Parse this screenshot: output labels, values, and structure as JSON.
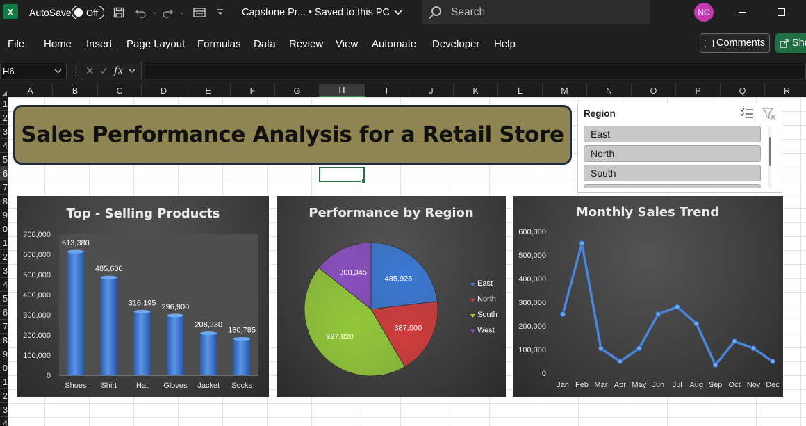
{
  "titlebar": {
    "app_icon": "X",
    "autosave_label": "AutoSave",
    "autosave_state": "Off",
    "doc_title": "Capstone Pr...  •  Saved to this PC",
    "search_placeholder": "Search",
    "user_initials": "NC"
  },
  "ribbon": {
    "tabs": [
      "File",
      "Home",
      "Insert",
      "Page Layout",
      "Formulas",
      "Data",
      "Review",
      "View",
      "Automate",
      "Developer",
      "Help"
    ],
    "comments_label": "Comments",
    "share_label": "Sha"
  },
  "formula_bar": {
    "name_box": "H6",
    "fx_label": "fx",
    "formula": ""
  },
  "sheet": {
    "columns": [
      "A",
      "B",
      "C",
      "D",
      "E",
      "F",
      "G",
      "H",
      "I",
      "J",
      "K",
      "L",
      "M",
      "N",
      "O",
      "P",
      "Q",
      "R"
    ],
    "selected_column": "H",
    "rows": [
      "1",
      "2",
      "3",
      "4",
      "5",
      "6",
      "7",
      "8",
      "9",
      "0",
      "1",
      "2",
      "3",
      "4",
      "5",
      "6",
      "7",
      "8",
      "9",
      "0",
      "1",
      "2",
      "3",
      "4"
    ],
    "selected_row_index": 5
  },
  "banner": {
    "title": "Sales Performance Analysis for a Retail Store"
  },
  "slicer": {
    "header": "Region",
    "items": [
      "East",
      "North",
      "South"
    ],
    "multiselect_icon": "multiselect-icon",
    "clear_filter_icon": "clear-filter-icon"
  },
  "chart_data": [
    {
      "type": "bar",
      "title": "Top - Selling Products",
      "categories": [
        "Shoes",
        "Shirt",
        "Hat",
        "Gloves",
        "Jacket",
        "Socks"
      ],
      "values": [
        613380,
        485600,
        316195,
        296900,
        208230,
        180785
      ],
      "value_labels": [
        "613,380",
        "485,600",
        "316,195",
        "296,900",
        "208,230",
        "180,785"
      ],
      "ylim": [
        0,
        700000
      ],
      "yticks": [
        "0",
        "100,000",
        "200,000",
        "300,000",
        "400,000",
        "500,000",
        "600,000",
        "700,000"
      ],
      "color": "#3a78d4",
      "xlabel": "",
      "ylabel": ""
    },
    {
      "type": "pie",
      "title": "Performance by Region",
      "categories": [
        "East",
        "North",
        "South",
        "West"
      ],
      "values": [
        485925,
        387000,
        927820,
        300345
      ],
      "value_labels": [
        "485,925",
        "387,000",
        "927,820",
        "300,345"
      ],
      "colors": [
        "#3a78d4",
        "#d03c3c",
        "#93c83a",
        "#8a4fc0"
      ],
      "legend": "right"
    },
    {
      "type": "line",
      "title": "Monthly Sales Trend",
      "categories": [
        "Jan",
        "Feb",
        "Mar",
        "Apr",
        "May",
        "Jun",
        "Jul",
        "Aug",
        "Sep",
        "Oct",
        "Nov",
        "Dec"
      ],
      "values": [
        250000,
        550000,
        105000,
        50000,
        105000,
        250000,
        280000,
        210000,
        35000,
        135000,
        105000,
        50000
      ],
      "ylim": [
        0,
        600000
      ],
      "yticks": [
        "0",
        "100,000",
        "200,000",
        "300,000",
        "400,000",
        "500,000",
        "600,000"
      ],
      "color": "#3a78d4",
      "xlabel": "",
      "ylabel": ""
    }
  ]
}
